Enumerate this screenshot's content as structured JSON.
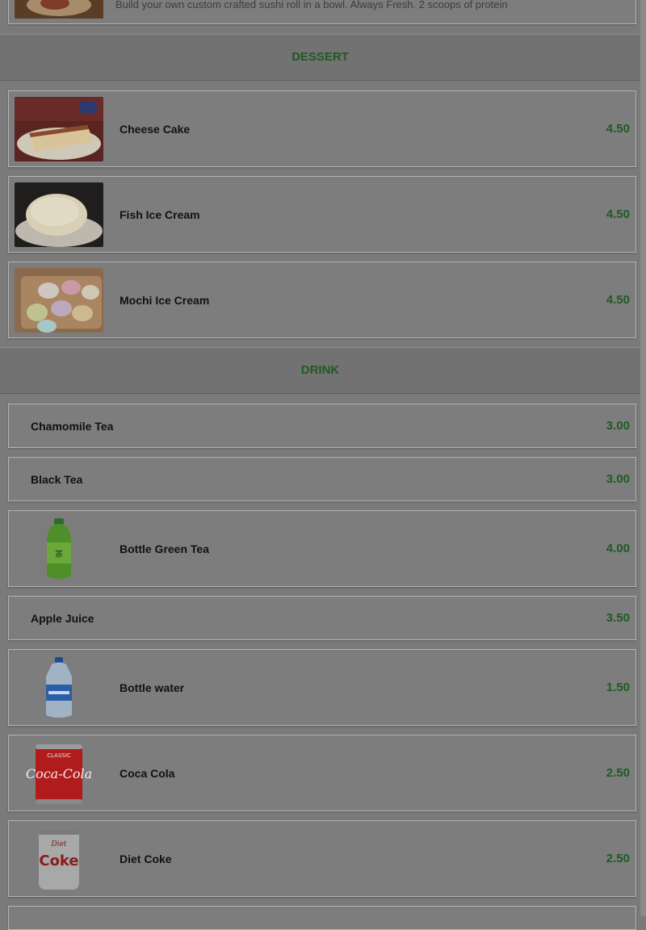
{
  "top_item": {
    "description": "Build your own custom crafted sushi roll in a bowl. Always Fresh. 2 scoops of protein"
  },
  "sections": {
    "dessert": {
      "title": "DESSERT",
      "items": [
        {
          "name": "Cheese Cake",
          "price": "4.50",
          "image": "cheesecake-photo"
        },
        {
          "name": "Fish Ice Cream",
          "price": "4.50",
          "image": "fish-ice-cream-photo"
        },
        {
          "name": "Mochi Ice Cream",
          "price": "4.50",
          "image": "mochi-photo"
        }
      ]
    },
    "drink": {
      "title": "DRINK",
      "items": [
        {
          "name": "Chamomile Tea",
          "price": "3.00"
        },
        {
          "name": "Black Tea",
          "price": "3.00"
        },
        {
          "name": "Bottle Green Tea",
          "price": "4.00",
          "image": "green-tea-bottle-photo"
        },
        {
          "name": "Apple Juice",
          "price": "3.50"
        },
        {
          "name": "Bottle water",
          "price": "1.50",
          "image": "water-bottle-photo"
        },
        {
          "name": "Coca Cola",
          "price": "2.50",
          "image": "coca-cola-can-photo"
        },
        {
          "name": "Diet Coke",
          "price": "2.50",
          "image": "diet-coke-can-photo"
        }
      ]
    }
  },
  "colors": {
    "overlay_background": "#7a7a7a",
    "accent_green": "#1f5a23"
  }
}
